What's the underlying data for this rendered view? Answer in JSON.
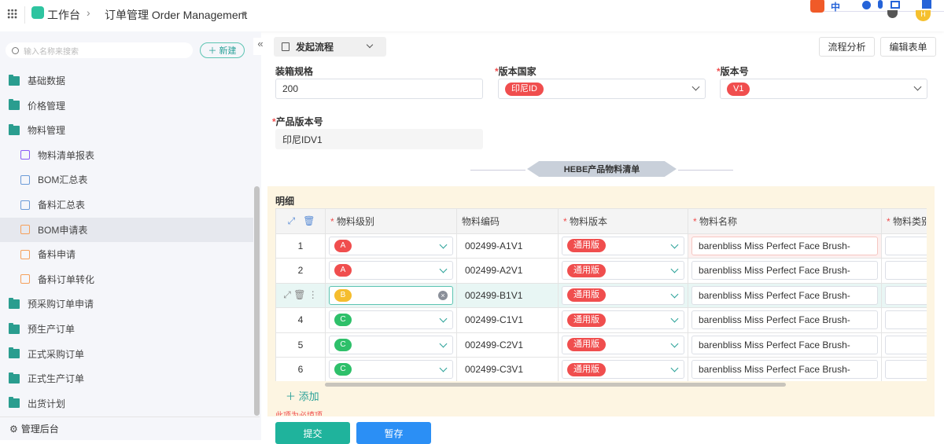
{
  "topbar": {
    "workspace": "工作台",
    "breadcrumb": "订单管理 Order Management",
    "ime": "中",
    "avatar": "H"
  },
  "sidebar": {
    "search_placeholder": "输入名称来搜索",
    "new_label": "新建",
    "items": [
      {
        "label": "基础数据",
        "type": "folder"
      },
      {
        "label": "价格管理",
        "type": "folder"
      },
      {
        "label": "物料管理",
        "type": "folder"
      },
      {
        "label": "物料清单报表",
        "type": "child",
        "icon": "report-icon",
        "color": "#8b5cf6"
      },
      {
        "label": "BOM汇总表",
        "type": "child",
        "icon": "document-icon",
        "color": "#6b9bd8"
      },
      {
        "label": "备料汇总表",
        "type": "child",
        "icon": "box-icon",
        "color": "#6b9bd8"
      },
      {
        "label": "BOM申请表",
        "type": "child",
        "icon": "document-icon",
        "color": "#f5a05a",
        "selected": true
      },
      {
        "label": "备料申请",
        "type": "child",
        "icon": "box-icon",
        "color": "#f5a05a"
      },
      {
        "label": "备料订单转化",
        "type": "child",
        "icon": "bag-icon",
        "color": "#f5a05a"
      },
      {
        "label": "预采购订单申请",
        "type": "folder"
      },
      {
        "label": "预生产订单",
        "type": "folder"
      },
      {
        "label": "正式采购订单",
        "type": "folder"
      },
      {
        "label": "正式生产订单",
        "type": "folder"
      },
      {
        "label": "出货计划",
        "type": "folder"
      }
    ],
    "footer": "管理后台"
  },
  "toolbar": {
    "flow_label": "发起流程",
    "analyze": "流程分析",
    "edit_form": "编辑表单"
  },
  "form": {
    "packing_label": "装箱规格",
    "packing_value": "200",
    "country_label": "版本国家",
    "country_value": "印尼ID",
    "version_label": "版本号",
    "version_value": "V1",
    "product_version_label": "产品版本号",
    "product_version_value": "印尼IDV1",
    "section_title": "HEBE产品物料清单"
  },
  "detail": {
    "title": "明细",
    "columns": [
      "物料级别",
      "物料编码",
      "物料版本",
      "物料名称",
      "物料类别"
    ],
    "rows": [
      {
        "index": "1",
        "level": "A",
        "level_color": "#f04e4e",
        "code": "002499-A1V1",
        "version": "通用版",
        "name": "barenbliss Miss Perfect Face Brush-"
      },
      {
        "index": "2",
        "level": "A",
        "level_color": "#f04e4e",
        "code": "002499-A2V1",
        "version": "通用版",
        "name": "barenbliss Miss Perfect Face Brush-"
      },
      {
        "index": "",
        "level": "B",
        "level_color": "#f5bd2e",
        "code": "002499-B1V1",
        "version": "通用版",
        "name": "barenbliss Miss Perfect Face Brush-"
      },
      {
        "index": "4",
        "level": "C",
        "level_color": "#2ec06a",
        "code": "002499-C1V1",
        "version": "通用版",
        "name": "barenbliss Miss Perfect Face Brush-"
      },
      {
        "index": "5",
        "level": "C",
        "level_color": "#2ec06a",
        "code": "002499-C2V1",
        "version": "通用版",
        "name": "barenbliss Miss Perfect Face Brush-"
      },
      {
        "index": "6",
        "level": "C",
        "level_color": "#2ec06a",
        "code": "002499-C3V1",
        "version": "通用版",
        "name": "barenbliss Miss Perfect Face Brush-"
      }
    ],
    "add_label": "添加",
    "error": "此项为必填项"
  },
  "actions": {
    "submit": "提交",
    "save_draft": "暂存"
  }
}
